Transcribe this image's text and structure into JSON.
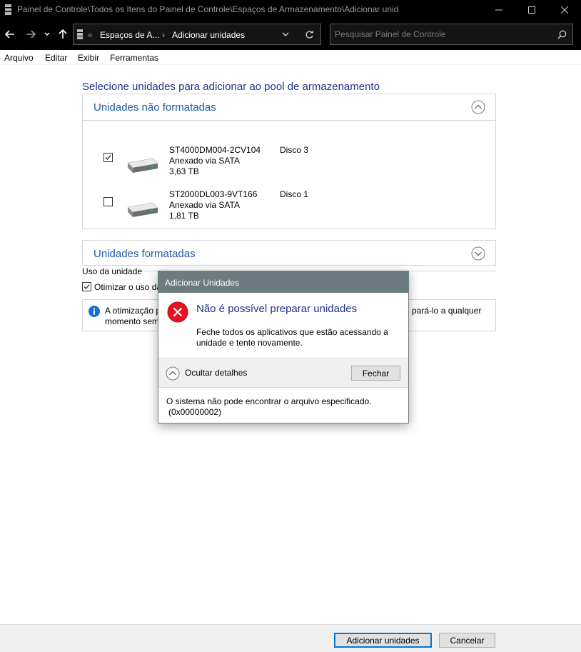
{
  "window": {
    "title": "Painel de Controle\\Todos os Itens do Painel de Controle\\Espaços de Armazenamento\\Adicionar unid",
    "icons": {
      "app": "storage-spaces-icon",
      "minimize": "minimize-icon",
      "maximize": "maximize-icon",
      "close": "close-icon"
    }
  },
  "address": {
    "overflow": "«",
    "crumb1": "Espaços de A...",
    "separator": "›",
    "crumb2": "Adicionar unidades",
    "search_placeholder": "Pesquisar Painel de Controle"
  },
  "menu": [
    "Arquivo",
    "Editar",
    "Exibir",
    "Ferramentas"
  ],
  "main": {
    "heading": "Selecione unidades para adicionar ao pool de armazenamento",
    "unformatted": {
      "title": "Unidades não formatadas",
      "drives": [
        {
          "model": "ST4000DM004-2CV104",
          "connection": "Anexado via SATA",
          "size": "3,63 TB",
          "disk": "Disco 3",
          "checked": true
        },
        {
          "model": "ST2000DL003-9VT166",
          "connection": "Anexado via SATA",
          "size": "1,81 TB",
          "disk": "Disco 1",
          "checked": false
        }
      ]
    },
    "formatted": {
      "title": "Unidades formatadas"
    },
    "usage_label": "Uso da unidade",
    "optimize_label": "Otimizar o uso da",
    "optimize_checked": true,
    "info_line1": "A otimização p",
    "info_line2": "momento sem",
    "info_right": "l pará-lo a qualquer"
  },
  "dialog": {
    "title": "Adicionar Unidades",
    "main": "Não é possível preparar unidades",
    "sub": "Feche todos os aplicativos que estão acessando a unidade e tente novamente.",
    "collapse_label": "Ocultar detalhes",
    "close_button": "Fechar",
    "detail_line1": "O sistema não pode encontrar o arquivo especificado.",
    "detail_line2": "(0x00000002)"
  },
  "footer": {
    "add_button": "Adicionar unidades",
    "cancel_button": "Cancelar"
  },
  "colors": {
    "accent_blue": "#1e5aa8",
    "heading_blue": "#1e3287",
    "error_red": "#e81123",
    "dialog_title_bg": "#6b7b80"
  }
}
